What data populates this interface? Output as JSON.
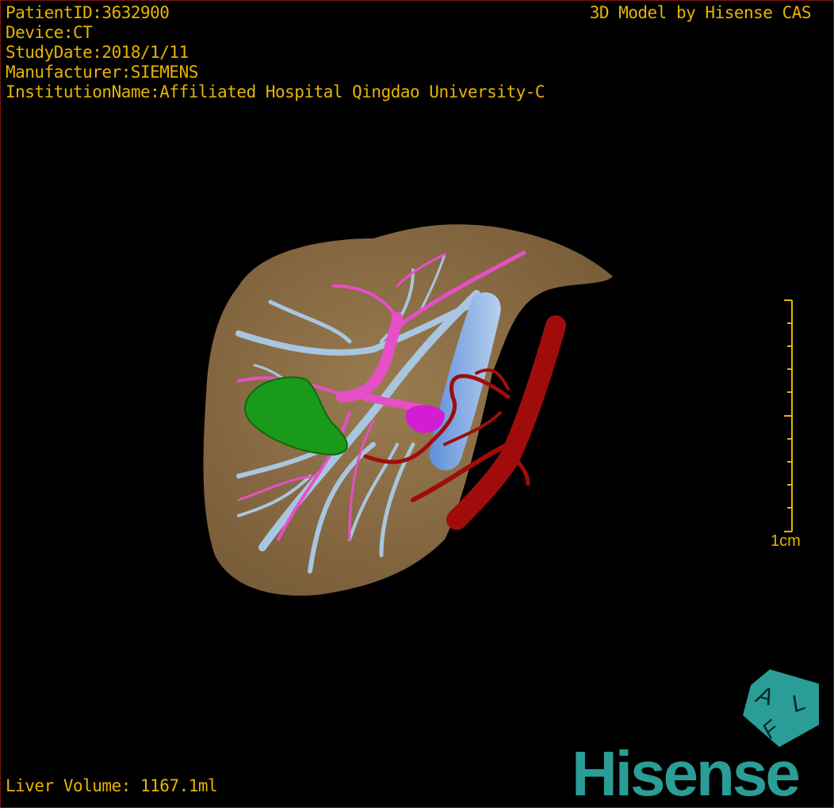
{
  "patient_info": {
    "patient_id": "PatientID:3632900",
    "device": "Device:CT",
    "study_date": "StudyDate:2018/1/11",
    "manufacturer": "Manufacturer:SIEMENS",
    "institution": "InstitutionName:Affiliated Hospital Qingdao University-C"
  },
  "credit": "3D Model by Hisense CAS",
  "liver_volume": "Liver Volume: 1167.1ml",
  "scale_bar": {
    "label": "1cm",
    "color": "#e8b400"
  },
  "orientation_cube": {
    "letters": [
      "A",
      "L",
      "F"
    ],
    "color": "#2a9d96"
  },
  "logo": {
    "text": "Hisense",
    "color": "#2a9d96"
  },
  "colors": {
    "liver": "#8b6d45",
    "hepatic_vein": "#a9c6e0",
    "portal_vein": "#e64fc8",
    "tumor": "#1a9a1a",
    "artery": "#a00c0c",
    "border": "#7a1414"
  }
}
